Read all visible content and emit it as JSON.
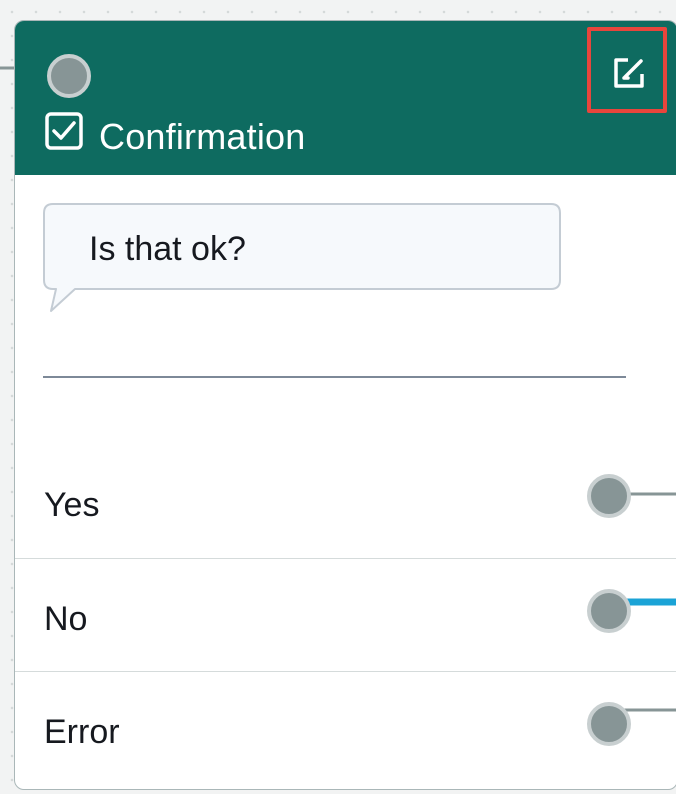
{
  "node": {
    "title": "Confirmation",
    "title_icon": "checkbox-checked-icon",
    "edit_icon": "edit-icon",
    "colors": {
      "header": "#0e6b60",
      "edit_highlight": "#e8453c",
      "active_connection": "#1ba3d6",
      "inactive_connection": "#879596"
    }
  },
  "prompt": {
    "text": "Is that ok?"
  },
  "branches": [
    {
      "label": "Yes",
      "connection": "inactive"
    },
    {
      "label": "No",
      "connection": "active"
    },
    {
      "label": "Error",
      "connection": "inactive"
    }
  ]
}
